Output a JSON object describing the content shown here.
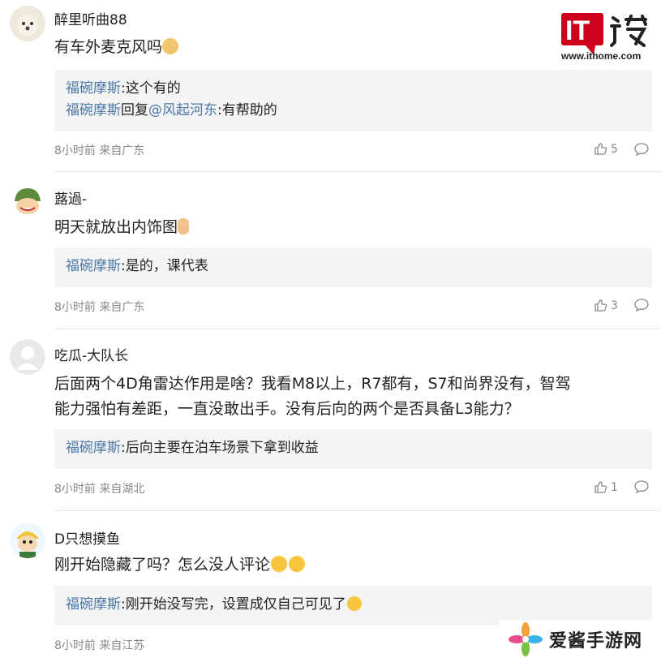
{
  "logo": {
    "text": "IT之家",
    "site": "www.ithome.com"
  },
  "watermark": {
    "text": "爱酱手游网"
  },
  "colors": {
    "reply_name": "#4a77a8",
    "logo_red": "#d0021b",
    "meta": "#888888"
  },
  "comments": [
    {
      "user": "醉里听曲88",
      "text": "有车外麦克风吗",
      "emoji": "emoji-doge-icon",
      "replies": [
        {
          "name": "福碗摩斯",
          "text": ":这个有的"
        },
        {
          "name": "福碗摩斯",
          "mid": "回复",
          "mention": "@风起河东",
          "text": ":有帮助的"
        }
      ],
      "meta": "8小时前 来自广东",
      "likes": "5"
    },
    {
      "user": "蕗過-",
      "text": "明天就放出内饰图",
      "emoji": "emoji-hand-icon",
      "replies": [
        {
          "name": "福碗摩斯",
          "text": ":是的，课代表"
        }
      ],
      "meta": "8小时前 来自广东",
      "likes": "3"
    },
    {
      "user": "吃瓜-大队长",
      "text_line1": "后面两个4D角雷达作用是啥？我看M8以上，R7都有，S7和尚界没有，智驾",
      "text_line2": "能力强怕有差距，一直没敢出手。没有后向的两个是否具备L3能力？",
      "replies": [
        {
          "name": "福碗摩斯",
          "text": ":后向主要在泊车场景下拿到收益"
        }
      ],
      "meta": "8小时前 来自湖北",
      "likes": "1"
    },
    {
      "user": "D只想摸鱼",
      "text": "刚开始隐藏了吗？怎么没人评论",
      "emoji": "emoji-smile-icon",
      "replies": [
        {
          "name": "福碗摩斯",
          "text": ":刚开始没写完，设置成仅自己可见了"
        }
      ],
      "meta": "8小时前 来自江苏"
    }
  ]
}
